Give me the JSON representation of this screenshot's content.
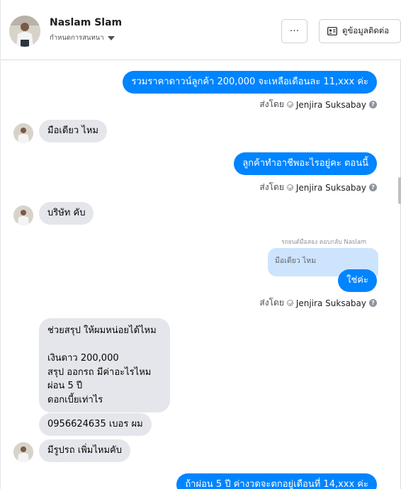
{
  "header": {
    "name": "Naslam Slam",
    "status": "กำหนดการสนทนา",
    "more_label": "···",
    "info_label": "ดูข้อมูลติดต่อ"
  },
  "messages": [
    {
      "dir": "out",
      "text": "รวมราคาดาวน์ลูกค้า 200,000 จะเหลือเดือนละ 11,xxx ค่ะ"
    },
    {
      "dir": "in",
      "text": "มือเดียว ไหม"
    },
    {
      "dir": "out",
      "text": "ลูกค้าทำอาชีพอะไรอยู่คะ ตอนนี้"
    },
    {
      "dir": "in",
      "text": "บริษัท คับ"
    },
    {
      "dir": "out",
      "text": "ใช่ค่ะ"
    },
    {
      "dir": "in",
      "text": "ช่วยสรุป ให้ผมหน่อยได้ไหม\n\nเงินดาว 200,000\nสรุป ออกรถ มีค่าอะไรไหม\nผ่อน 5 ปี\nดอกเบี้ยเท่าไร"
    },
    {
      "dir": "in",
      "text": "0956624635 เบอร ผม"
    },
    {
      "dir": "in",
      "text": "มีรูปรถ เพิ่มไหมคับ"
    },
    {
      "dir": "out",
      "text": "ถ้าผ่อน 5 ปี ค่างวดจะตกอยู่เดือนที่ 14,xxx ค่ะ"
    }
  ],
  "sent_by": {
    "prefix": "ส่งโดย",
    "agent": "Jenjira Suksabay",
    "help": "?"
  },
  "reply": {
    "label": "รถยนต์มือสอง ตอบกลับ Naslam",
    "quoted_text": "มือเดียว ไหม"
  },
  "colors": {
    "outgoing": "#0084ff",
    "incoming": "#e4e6eb",
    "quoted": "#cde4fe"
  }
}
